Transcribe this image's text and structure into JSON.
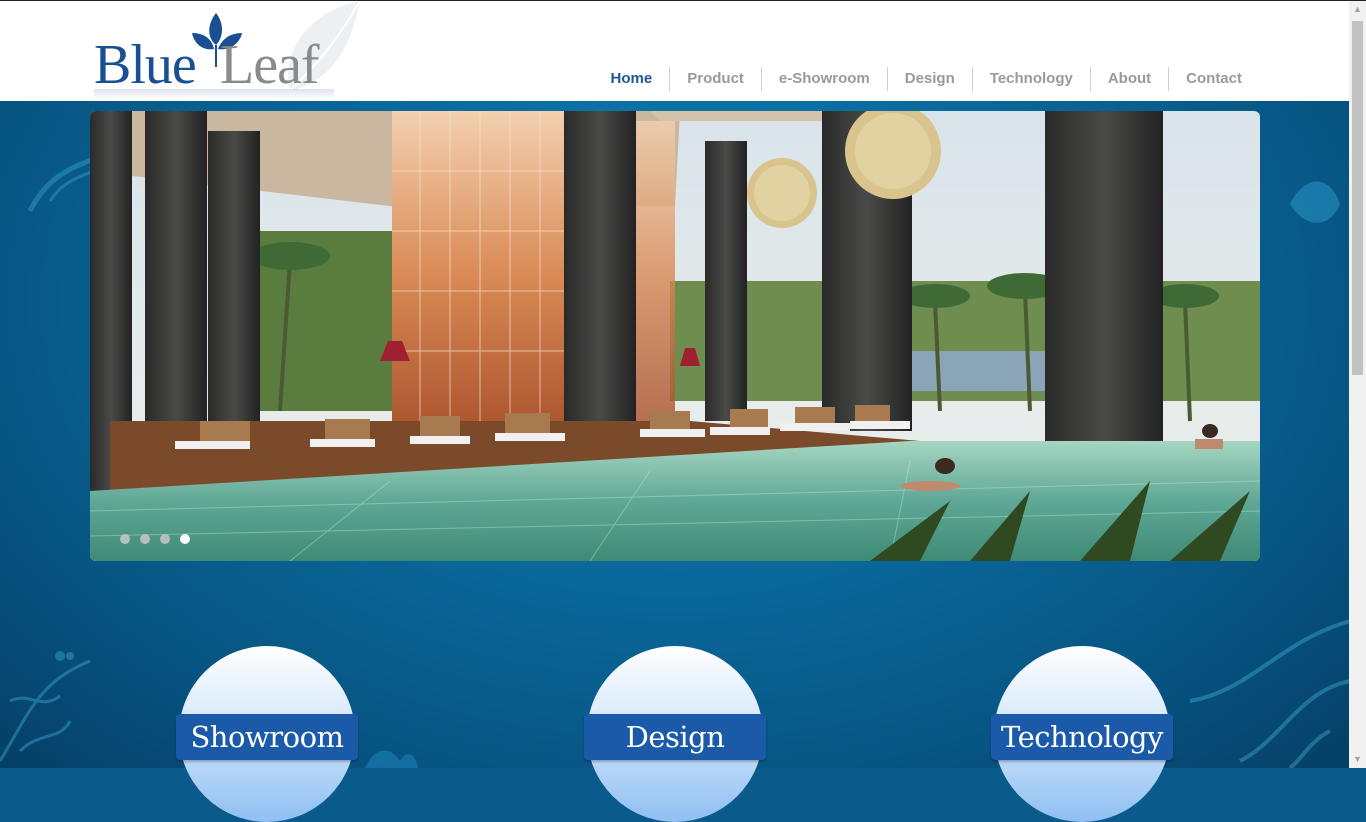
{
  "header": {
    "logo": {
      "word1": "Blue",
      "word2": "Leaf"
    },
    "nav": [
      {
        "label": "Home",
        "active": true
      },
      {
        "label": "Product",
        "active": false
      },
      {
        "label": "e-Showroom",
        "active": false
      },
      {
        "label": "Design",
        "active": false
      },
      {
        "label": "Technology",
        "active": false
      },
      {
        "label": "About",
        "active": false
      },
      {
        "label": "Contact",
        "active": false
      }
    ]
  },
  "slider": {
    "image": "resort-pool-pavilion-photo",
    "dots": 4,
    "active_dot": 4
  },
  "features": [
    {
      "label": "Showroom"
    },
    {
      "label": "Design"
    },
    {
      "label": "Technology"
    }
  ],
  "colors": {
    "brand_blue": "#1a4f94",
    "nav_active": "#1a5a96",
    "nav_inactive": "#9a9a9a",
    "page_bg": "#0b6a9c",
    "feature_band": "#1a5aa8"
  }
}
